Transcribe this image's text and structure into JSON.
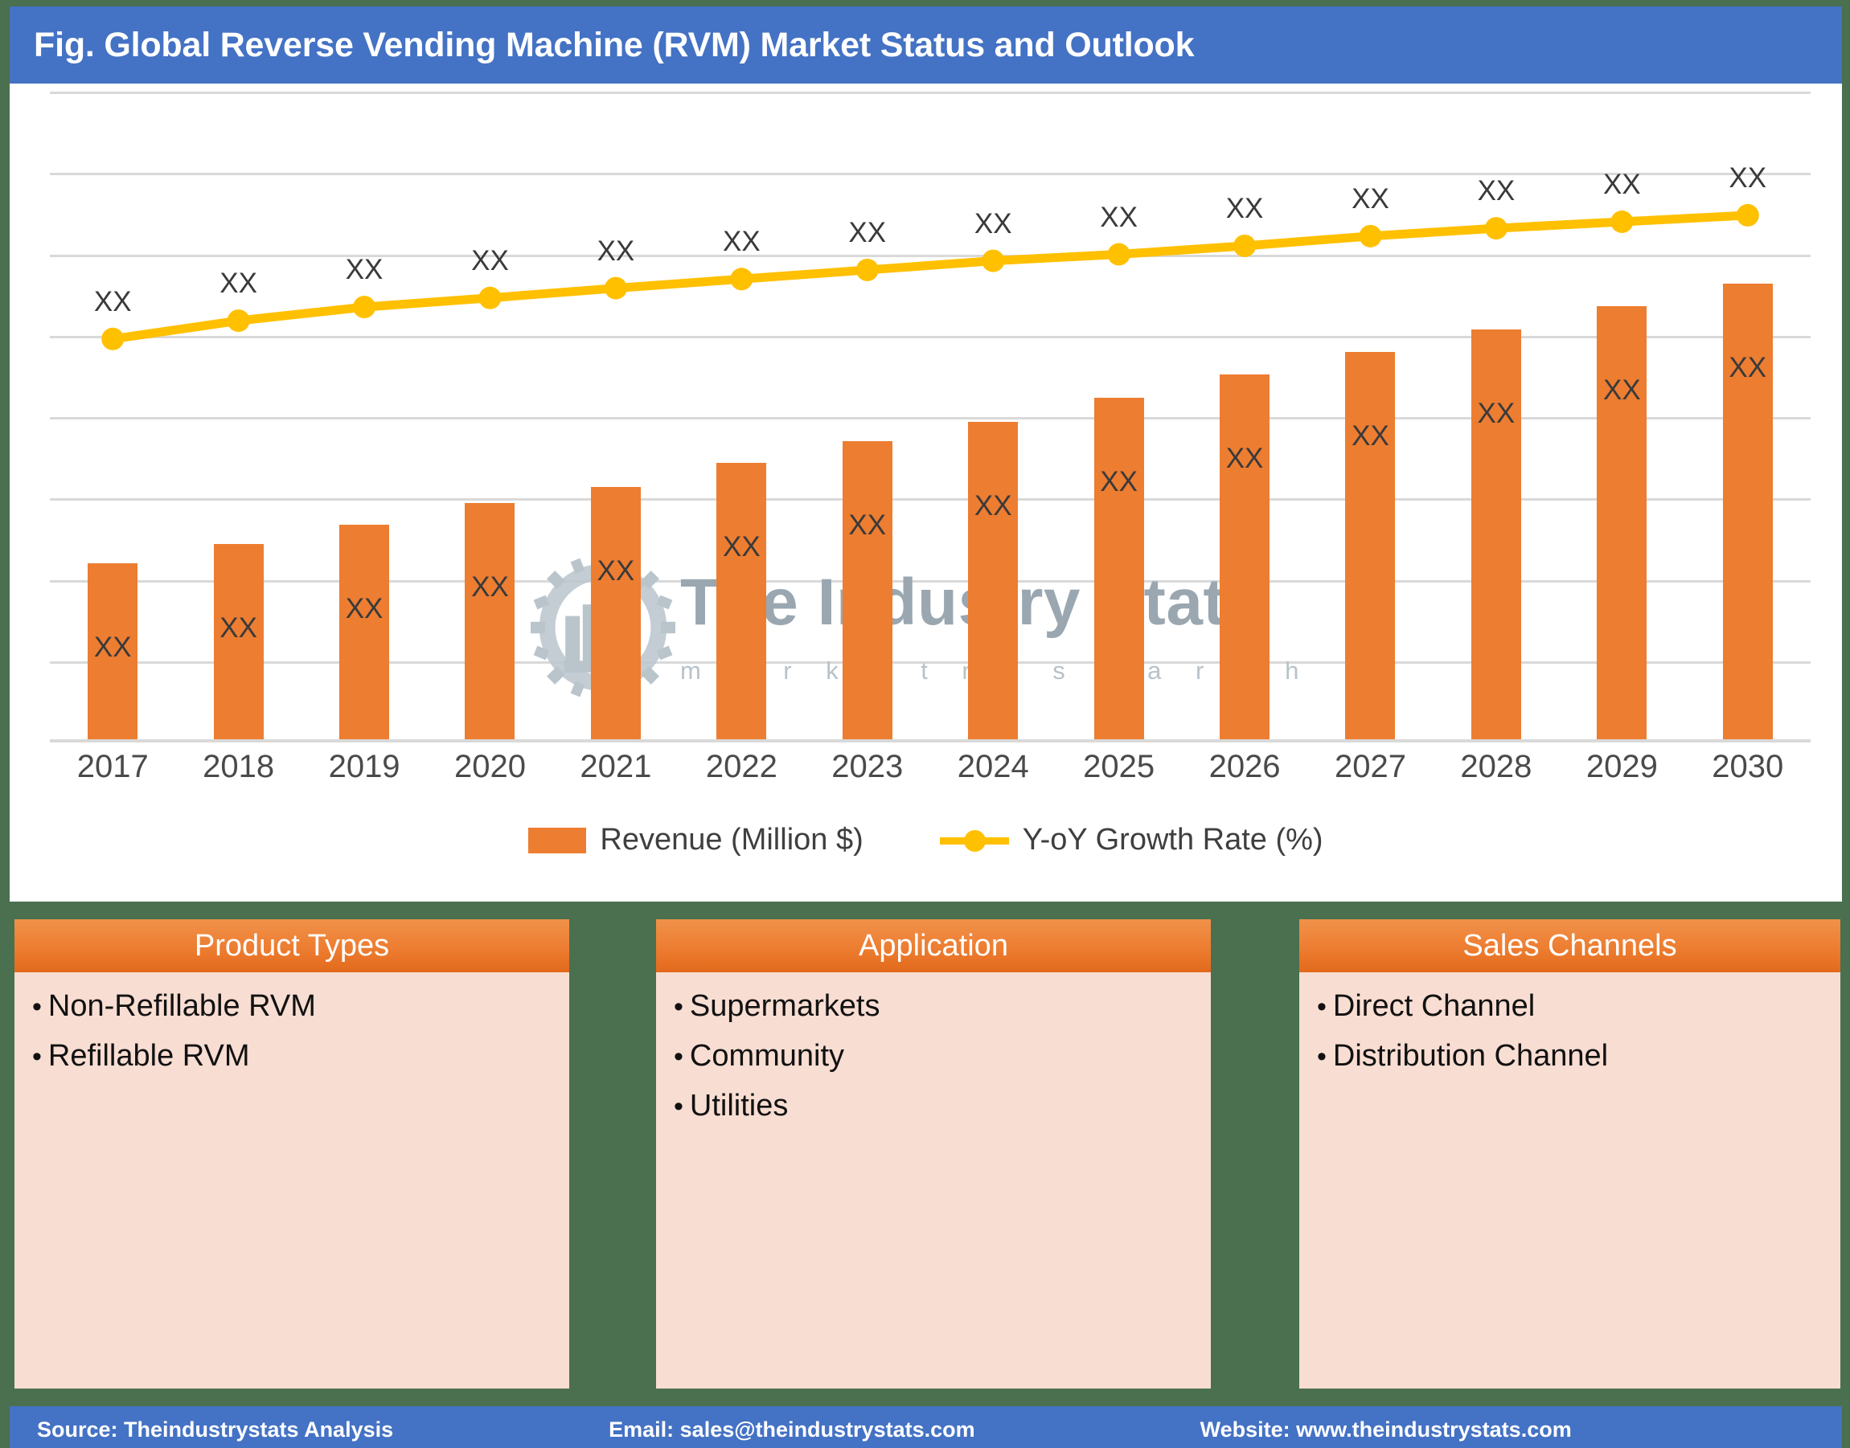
{
  "header": {
    "title": "Fig. Global Reverse Vending Machine (RVM) Market Status and Outlook",
    "background_color": "#4472C4"
  },
  "watermark": {
    "main": "The Industry Stats",
    "sub": "m a r k e t   r e s e a r c h",
    "logo_icon": "gear-wrench-factory-logo"
  },
  "legend": {
    "items": [
      {
        "label": "Revenue (Million $)",
        "marker": "square",
        "color": "#ED7D31"
      },
      {
        "label": "Y-oY Growth Rate (%)",
        "marker": "line-dot",
        "color": "#FFC000"
      }
    ]
  },
  "chart_data": {
    "type": "bar",
    "title": "Fig. Global Reverse Vending Machine (RVM) Market Status and Outlook",
    "xlabel": "",
    "ylabel": "",
    "grid": true,
    "legend_position": "bottom",
    "axis_note": "Values are masked as 'XX' in the source figure (sample/teaser chart)",
    "categories": [
      "2017",
      "2018",
      "2019",
      "2020",
      "2021",
      "2022",
      "2023",
      "2024",
      "2025",
      "2026",
      "2027",
      "2028",
      "2029",
      "2030"
    ],
    "ylim": [
      0,
      100
    ],
    "gridline_count": 8,
    "series": [
      {
        "name": "Revenue (Million $)",
        "type": "bar",
        "color": "#ED7D31",
        "values": [
          27.5,
          30.5,
          33.5,
          36.8,
          39.3,
          43.0,
          46.3,
          49.3,
          53.0,
          56.5,
          60.0,
          63.5,
          67.0,
          70.5
        ],
        "data_labels": [
          "XX",
          "XX",
          "XX",
          "XX",
          "XX",
          "XX",
          "XX",
          "XX",
          "XX",
          "XX",
          "XX",
          "XX",
          "XX",
          "XX"
        ]
      },
      {
        "name": "Y-oY Growth Rate (%)",
        "type": "line",
        "color": "#FFC000",
        "values": [
          62.0,
          64.8,
          66.9,
          68.3,
          69.8,
          71.2,
          72.6,
          74.0,
          75.0,
          76.3,
          77.8,
          79.0,
          80.0,
          81.0
        ],
        "data_labels": [
          "XX",
          "XX",
          "XX",
          "XX",
          "XX",
          "XX",
          "XX",
          "XX",
          "XX",
          "XX",
          "XX",
          "XX",
          "XX",
          "XX"
        ]
      }
    ]
  },
  "panels": [
    {
      "title": "Product Types",
      "items": [
        "Non-Refillable RVM",
        "Refillable RVM"
      ]
    },
    {
      "title": "Application",
      "items": [
        "Supermarkets",
        "Community",
        "Utilities"
      ]
    },
    {
      "title": "Sales Channels",
      "items": [
        "Direct Channel",
        "Distribution Channel"
      ]
    }
  ],
  "footer": {
    "source": "Source: Theindustrystats Analysis",
    "email": "Email: sales@theindustrystats.com",
    "website": "Website: www.theindustrystats.com",
    "background_color": "#4472C4"
  }
}
